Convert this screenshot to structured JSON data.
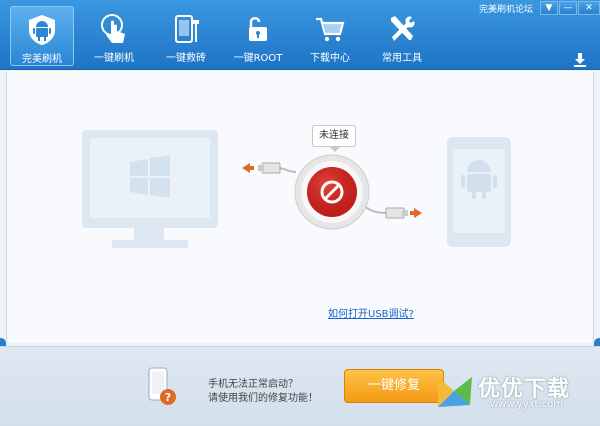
{
  "window": {
    "forum_link": "完美刷机论坛",
    "menu_btn": "▼",
    "min_btn": "—",
    "close_btn": "✕"
  },
  "nav": {
    "tabs": [
      {
        "label": "完美刷机",
        "active": true
      },
      {
        "label": "一键刷机"
      },
      {
        "label": "一键救砖"
      },
      {
        "label": "一键ROOT"
      },
      {
        "label": "下载中心"
      },
      {
        "label": "常用工具"
      }
    ]
  },
  "main": {
    "status": "未连接",
    "usb_debug_link": "如何打开USB调试?"
  },
  "bottom": {
    "message_line1": "手机无法正常启动？",
    "message_line2": "请使用我们的修复功能！",
    "fix_button": "一键修复"
  },
  "watermark": {
    "text": "优优下载",
    "url": "www.yyxt.com"
  },
  "colors": {
    "toolbar": "#2a83d4",
    "accent_orange": "#f5a01a",
    "disconnect_red": "#c8201c",
    "faint_device": "#dde8f3"
  }
}
